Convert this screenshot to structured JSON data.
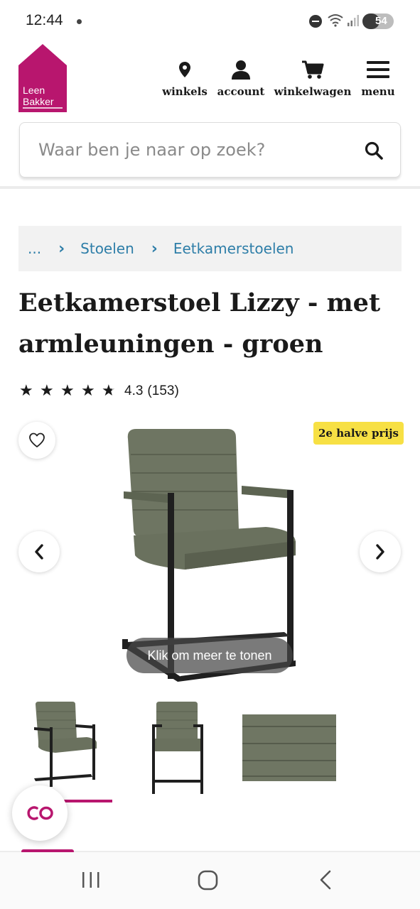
{
  "status_bar": {
    "time": "12:44",
    "battery": "54",
    "battery_level": 0.54
  },
  "header": {
    "logo_line1": "Leen",
    "logo_line2": "Bakker",
    "brand_color": "#b8166e",
    "nav": [
      {
        "label": "winkels",
        "icon": "map-pin-icon"
      },
      {
        "label": "account",
        "icon": "person-icon"
      },
      {
        "label": "winkelwagen",
        "icon": "cart-icon"
      },
      {
        "label": "menu",
        "icon": "hamburger-icon"
      }
    ]
  },
  "search": {
    "placeholder": "Waar ben je naar op zoek?",
    "value": ""
  },
  "breadcrumb": {
    "items": [
      "...",
      "Stoelen",
      "Eetkamerstoelen"
    ],
    "link_color": "#2e7ea8"
  },
  "product": {
    "title": "Eetkamerstoel Lizzy - met armleuningen - groen",
    "rating_value": "4.3",
    "rating_count": "(153)",
    "rating_stars": 4.3,
    "promo_badge": "2e halve prijs",
    "promo_color": "#f7e044",
    "image_tooltip": "Klik om meer te tonen",
    "thumbnails": [
      {
        "name": "chair-angle-view",
        "active": true
      },
      {
        "name": "chair-front-view",
        "active": false
      },
      {
        "name": "fabric-detail-view",
        "active": false
      }
    ]
  },
  "chat": {
    "icon": "chat-co-icon"
  },
  "system_nav": {
    "buttons": [
      "recent-apps-icon",
      "home-icon",
      "back-icon"
    ]
  }
}
